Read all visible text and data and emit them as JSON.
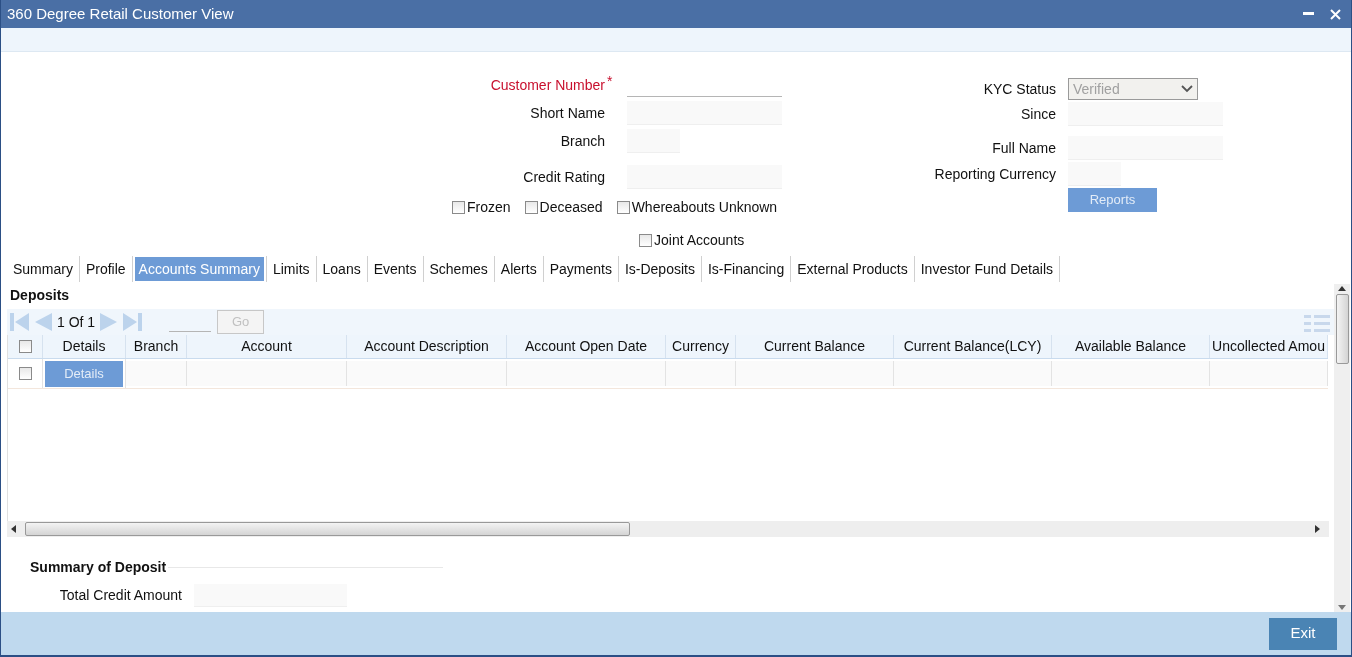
{
  "window": {
    "title": "360 Degree Retail Customer View"
  },
  "form": {
    "required_mark": "*",
    "left_fields": [
      {
        "label": "Customer Number",
        "required": true,
        "kind": "underline"
      },
      {
        "label": "Short Name",
        "required": false,
        "kind": "box"
      },
      {
        "label": "Branch",
        "required": false,
        "kind": "box"
      },
      {
        "label": "Credit Rating",
        "required": false,
        "kind": "box"
      }
    ],
    "flags": [
      {
        "label": "Frozen",
        "checked": false
      },
      {
        "label": "Deceased",
        "checked": false
      },
      {
        "label": "Whereabouts Unknown",
        "checked": false
      }
    ],
    "joint_accounts": {
      "label": "Joint Accounts",
      "checked": false
    },
    "kyc_status": {
      "label": "KYC Status",
      "value": "Verified",
      "disabled": true
    },
    "right_fields": [
      {
        "label": "Since"
      },
      {
        "label": "Full Name"
      },
      {
        "label": "Reporting Currency"
      }
    ],
    "reports_button": {
      "label": "Reports",
      "disabled": true
    }
  },
  "tabs": [
    {
      "label": "Summary",
      "selected": false
    },
    {
      "label": "Profile",
      "selected": false
    },
    {
      "label": "Accounts Summary",
      "selected": true
    },
    {
      "label": "Limits",
      "selected": false
    },
    {
      "label": "Loans",
      "selected": false
    },
    {
      "label": "Events",
      "selected": false
    },
    {
      "label": "Schemes",
      "selected": false
    },
    {
      "label": "Alerts",
      "selected": false
    },
    {
      "label": "Payments",
      "selected": false
    },
    {
      "label": "Is-Deposits",
      "selected": false
    },
    {
      "label": "Is-Financing",
      "selected": false
    },
    {
      "label": "External Products",
      "selected": false
    },
    {
      "label": "Investor Fund Details",
      "selected": false
    }
  ],
  "deposits": {
    "title": "Deposits",
    "pager": {
      "current": "1",
      "of": "Of",
      "total": "1",
      "go": "Go"
    },
    "header_checked": false,
    "columns": [
      "Details",
      "Branch",
      "Account",
      "Account Description",
      "Account Open Date",
      "Currency",
      "Current Balance",
      "Current Balance(LCY)",
      "Available Balance",
      "Uncollected Amou"
    ],
    "rows": [
      {
        "checked": false,
        "details_button": "Details"
      }
    ]
  },
  "summary": {
    "title": "Summary of Deposit",
    "fields": [
      {
        "label": "Total Credit Amount"
      }
    ]
  },
  "footer": {
    "exit_button": "Exit"
  }
}
